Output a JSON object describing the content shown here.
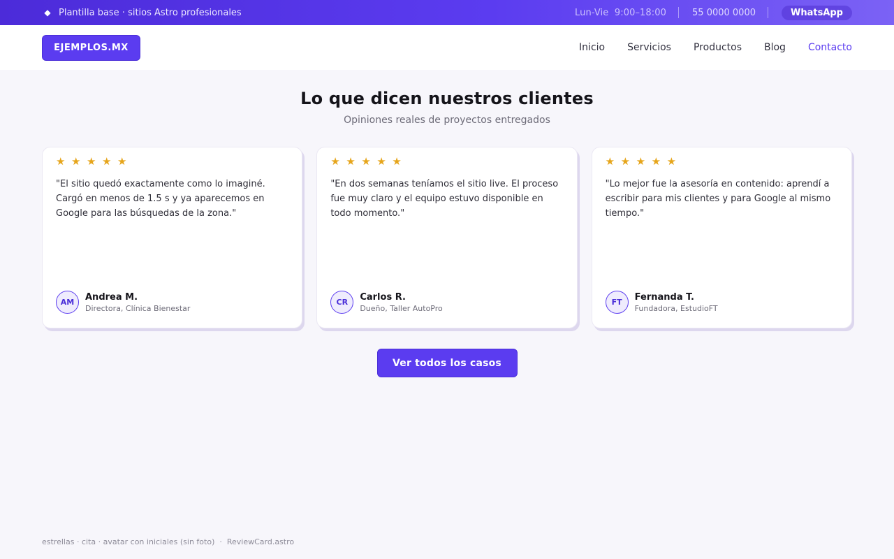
{
  "topbar": {
    "tagline": "Plantilla base · sitios Astro profesionales",
    "hours": "Lun-Vie  9:00–18:00",
    "phone": "55 0000 0000",
    "whatsapp_label": "WhatsApp"
  },
  "header": {
    "logo": "EJEMPLOS.MX",
    "nav": [
      "Inicio",
      "Servicios",
      "Productos",
      "Blog",
      "Contacto"
    ],
    "active_nav": "Contacto"
  },
  "section": {
    "title": "Lo que dicen nuestros clientes",
    "subtitle": "Opiniones reales de proyectos entregados"
  },
  "reviews": [
    {
      "rating": 5,
      "quote": "\"El sitio quedó exactamente como lo imaginé. Cargó en menos de 1.5 s y ya aparecemos en Google para las búsquedas de la zona.\"",
      "initials": "AM",
      "name": "Andrea M.",
      "role": "Directora, Clínica Bienestar"
    },
    {
      "rating": 5,
      "quote": "\"En dos semanas teníamos el sitio live. El proceso fue muy claro y el equipo estuvo disponible en todo momento.\"",
      "initials": "CR",
      "name": "Carlos R.",
      "role": "Dueño, Taller AutoPro"
    },
    {
      "rating": 5,
      "quote": "\"Lo mejor fue la asesoría en contenido: aprendí a escribir para mis clientes y para Google al mismo tiempo.\"",
      "initials": "FT",
      "name": "Fernanda T.",
      "role": "Fundadora, EstudioFT"
    }
  ],
  "cta_label": "Ver todos los casos",
  "footer_note": "estrellas · cita · avatar con iniciales (sin foto)  ·  ReviewCard.astro",
  "icons": {
    "tagline": "diamond-icon",
    "rating": "star-icon"
  },
  "colors": {
    "accent": "#5b3cf0",
    "star": "#e6a51b",
    "background": "#f7f6fb"
  }
}
